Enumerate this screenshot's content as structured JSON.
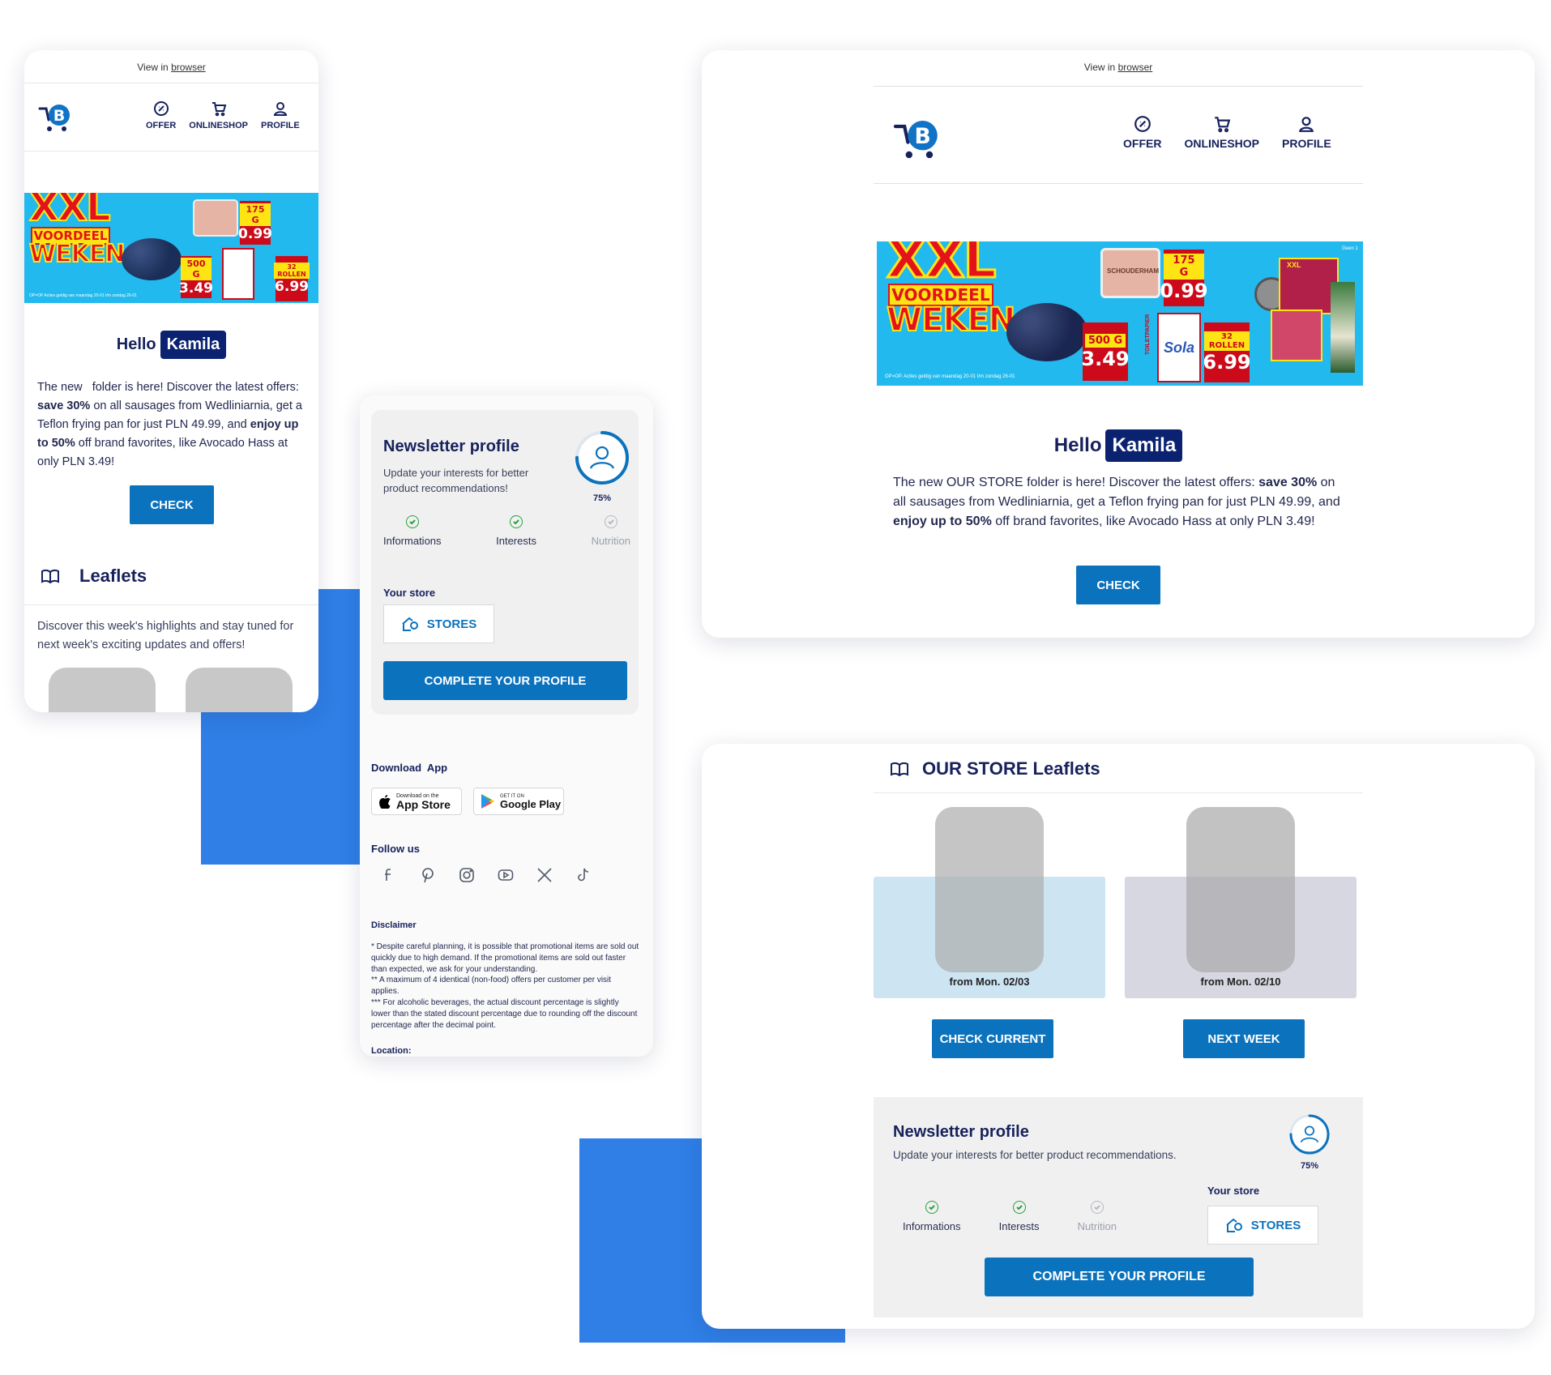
{
  "colors": {
    "brand_blue": "#0b72be",
    "navy": "#17215c",
    "accent_block": "#2f7fe6",
    "banner_bg": "#22b9ee",
    "price_red": "#cc0a1a",
    "xxl_yellow": "#ffe414"
  },
  "header": {
    "view_in": "View in",
    "browser_link": "browser"
  },
  "nav": {
    "offer": "OFFER",
    "onlineshop": "ONLINESHOP",
    "profile": "PROFILE",
    "logo_letter": "B"
  },
  "banner": {
    "xxl": "XXL",
    "voordeel": "VOORDEEL",
    "weken": "WEKEN",
    "w1": "175 G",
    "p1": "0.99",
    "w2": "500 G",
    "p2": "3.49",
    "w3": "32 ROLLEN",
    "p3": "6.99",
    "fine": "OP=OP. Acties geldig van maandag 20-01 t/m zondag 26-01",
    "fine_short": "OP=OP Acties geldig van maandag 20-01 t/m zondag 26-01",
    "geen": "Geen 1",
    "toiletpapier": "TOILETPAPIER",
    "sola": "Sola",
    "schouder": "SCHOUDERHAM",
    "xxl_small": "XXL"
  },
  "greeting": {
    "hello": "Hello",
    "name": "Kamila"
  },
  "mobile": {
    "intro_a": "The new",
    "intro_b": "folder is here! Discover the latest offers: ",
    "save": "save 30%",
    "intro_c": " on all sausages from Wedliniarnia, get a Teflon frying pan for just PLN 49.99, and ",
    "enjoy": "enjoy up to 50%",
    "intro_d": " off brand favorites, like Avocado Hass at only PLN 3.49!",
    "check": "CHECK",
    "leaflets_title": "Leaflets",
    "leaflets_desc": "Discover this week's highlights and stay tuned for next week's exciting updates and offers!"
  },
  "desktop": {
    "intro_a": "The new OUR STORE folder is here! Discover the latest offers: ",
    "save": "save 30%",
    "intro_c": " on all sausages from Wedliniarnia, get a Teflon frying pan for just PLN 49.99, and ",
    "enjoy": "enjoy up to 50%",
    "intro_d": " off brand favorites, like Avocado Hass at only PLN 3.49!",
    "check": "CHECK"
  },
  "leaflets": {
    "title": "OUR STORE Leaflets",
    "current_date": "from Mon. 02/03",
    "next_date": "from Mon. 02/10",
    "check_current": "CHECK CURRENT",
    "next_week": "NEXT WEEK"
  },
  "newsletter": {
    "title": "Newsletter profile",
    "desc": "Update your interests for better product recommendations!",
    "desc_desktop": "Update your interests for better product recommendations.",
    "progress_label": "75%",
    "progress": 0.75,
    "steps": [
      {
        "label": "Informations",
        "done": true
      },
      {
        "label": "Interests",
        "done": true
      },
      {
        "label": "Nutrition",
        "done": false
      }
    ],
    "your_store": "Your store",
    "stores": "STORES",
    "complete": "COMPLETE YOUR PROFILE"
  },
  "footer": {
    "download_app": "Download  App",
    "appstore_small": "Download on the",
    "appstore": "App Store",
    "gplay_small": "GET IT ON",
    "gplay": "Google Play",
    "follow": "Follow us",
    "social": [
      "facebook-icon",
      "pinterest-icon",
      "instagram-icon",
      "youtube-icon",
      "x-icon",
      "tiktok-icon"
    ],
    "disclaimer_title": "Disclaimer",
    "disclaimer_1": "* Despite careful planning, it is possible that promotional items are sold out quickly due to high demand. If the promotional items are sold out faster than expected, we ask for your understanding.",
    "disclaimer_2": "** A maximum of 4 identical (non-food) offers per customer per visit applies.",
    "disclaimer_3": "*** For alcoholic beverages, the actual discount percentage is slightly lower than the stated discount percentage due to rounding off the discount percentage after the decimal point.",
    "location": "Location:"
  }
}
